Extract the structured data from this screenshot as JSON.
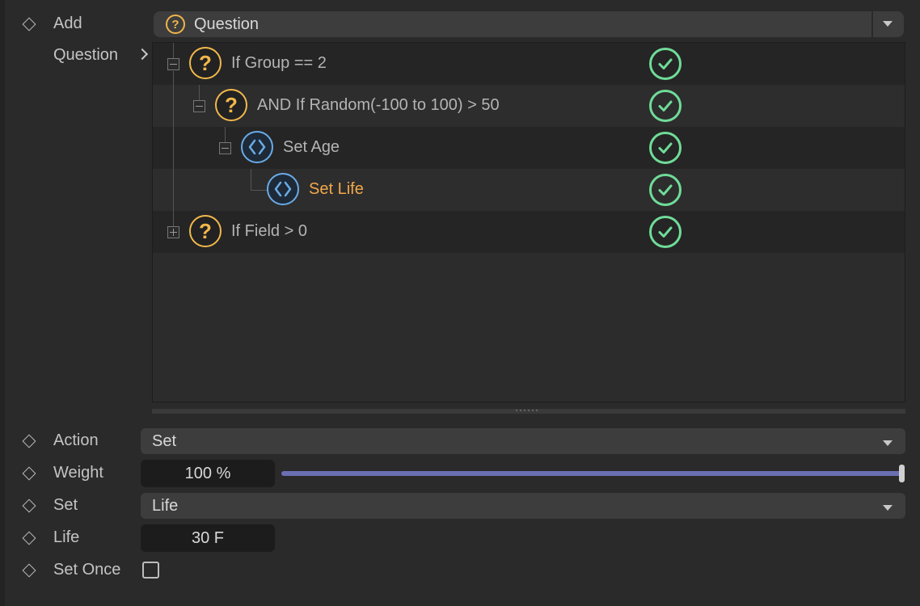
{
  "add": {
    "label": "Add",
    "value": "Question"
  },
  "breadcrumb": {
    "label": "Question"
  },
  "tree": {
    "nodes": [
      {
        "text": "If Group == 2",
        "type": "question",
        "expanded": true,
        "enabled": true
      },
      {
        "text": "AND If Random(-100 to 100) > 50",
        "type": "question",
        "expanded": true,
        "enabled": true
      },
      {
        "text": "Set Age",
        "type": "action",
        "expanded": true,
        "enabled": true
      },
      {
        "text": "Set Life",
        "type": "action",
        "selected": true,
        "enabled": true
      },
      {
        "text": "If Field > 0",
        "type": "question",
        "expanded": false,
        "enabled": true
      }
    ]
  },
  "properties": {
    "action": {
      "label": "Action",
      "value": "Set"
    },
    "weight": {
      "label": "Weight",
      "value": "100 %",
      "slider_fraction": 1.0
    },
    "set": {
      "label": "Set",
      "value": "Life"
    },
    "life": {
      "label": "Life",
      "value": "30 F"
    },
    "set_once": {
      "label": "Set Once",
      "checked": false
    }
  },
  "colors": {
    "question": "#f2b84b",
    "action": "#6aabe6",
    "check": "#6fdc98",
    "selected_text": "#f2a84a",
    "slider": "#6a6fb3"
  }
}
